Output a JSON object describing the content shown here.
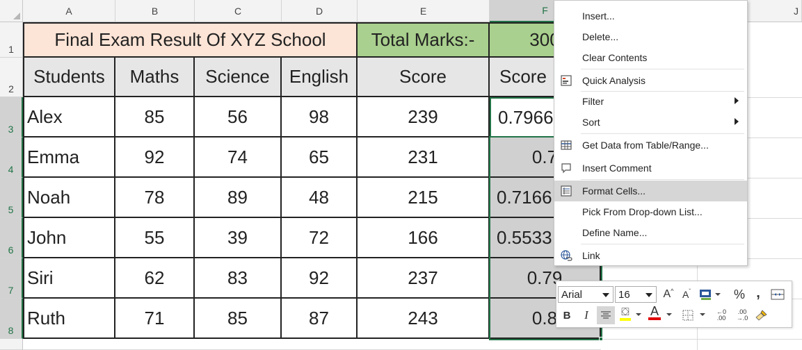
{
  "columns": [
    "A",
    "B",
    "C",
    "D",
    "E",
    "F",
    "J"
  ],
  "rows": [
    "1",
    "2",
    "3",
    "4",
    "5",
    "6",
    "7",
    "8"
  ],
  "sheet": {
    "title": "Final Exam Result Of XYZ School",
    "total_label": "Total Marks:-",
    "total_value": "300",
    "headers": [
      "Students",
      "Maths",
      "Science",
      "English",
      "Score",
      "Score"
    ],
    "data": [
      {
        "name": "Alex",
        "maths": "85",
        "science": "56",
        "english": "98",
        "score": "239",
        "pct": "0.7966"
      },
      {
        "name": "Emma",
        "maths": "92",
        "science": "74",
        "english": "65",
        "score": "231",
        "pct": "0.7"
      },
      {
        "name": "Noah",
        "maths": "78",
        "science": "89",
        "english": "48",
        "score": "215",
        "pct": "0.7166"
      },
      {
        "name": "John",
        "maths": "55",
        "science": "39",
        "english": "72",
        "score": "166",
        "pct": "0.5533"
      },
      {
        "name": "Siri",
        "maths": "62",
        "science": "83",
        "english": "92",
        "score": "237",
        "pct": "0.79"
      },
      {
        "name": "Ruth",
        "maths": "71",
        "science": "85",
        "english": "87",
        "score": "243",
        "pct": "0.8"
      }
    ]
  },
  "colors": {
    "title_fill": "#fce4d6",
    "total_fill": "#a9d08e",
    "header_fill": "#e7e6e6",
    "selection_fill": "#d0d0d0",
    "accent": "#217346"
  },
  "context_menu": {
    "insert": "Insert...",
    "delete": "Delete...",
    "clear_contents": "Clear Contents",
    "quick_analysis": "Quick Analysis",
    "filter": "Filter",
    "sort": "Sort",
    "get_data": "Get Data from Table/Range...",
    "insert_comment": "Insert Comment",
    "format_cells": "Format Cells...",
    "pick_dropdown": "Pick From Drop-down List...",
    "define_name": "Define Name...",
    "link": "Link"
  },
  "mini_toolbar": {
    "font_name": "Arial",
    "font_size": "16",
    "grow_font": "A",
    "shrink_font": "A",
    "percent": "%",
    "comma": ",",
    "bold": "B",
    "italic": "I",
    "font_color": "A",
    "inc_decimal_top": "←0",
    "inc_decimal_bottom": ".00",
    "dec_decimal_top": ".00",
    "dec_decimal_bottom": "→.0",
    "font_color_bar": "#e00000",
    "fill_color_bar": "#ffff00"
  }
}
